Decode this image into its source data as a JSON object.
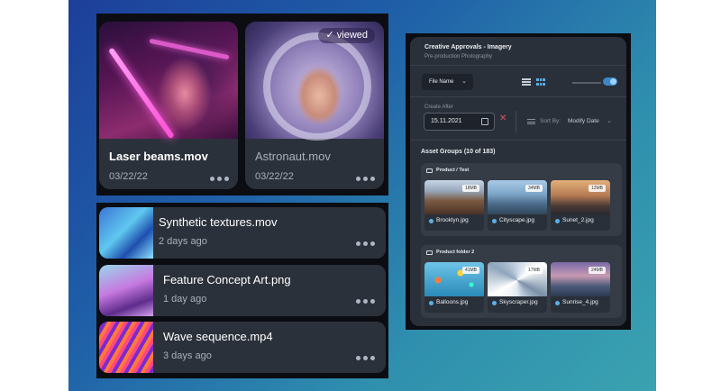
{
  "cards": [
    {
      "title": "Laser beams.mov",
      "date": "03/22/22",
      "viewed": ""
    },
    {
      "title": "Astronaut.mov",
      "date": "03/22/22",
      "viewed": "✓ viewed"
    }
  ],
  "list": [
    {
      "title": "Synthetic textures.mov",
      "subtitle": "2 days ago"
    },
    {
      "title": "Feature Concept Art.png",
      "subtitle": "1 day ago"
    },
    {
      "title": "Wave sequence.mp4",
      "subtitle": "3 days ago"
    }
  ],
  "app": {
    "title": "Creative Approvals - Imagery",
    "subtitle": "Pre-production Photography",
    "file_dropdown": "File Name",
    "create_after_label": "Create After",
    "create_after_value": "15.11.2021",
    "sort_label": "Sort By:",
    "sort_value": "Modify Date",
    "groups_title": "Asset Groups (10 of 183)",
    "groups": [
      {
        "name": "Product / Test",
        "assets": [
          {
            "name": "Brooklyn.jpg",
            "size": "18MB"
          },
          {
            "name": "Cityscape.jpg",
            "size": "34MB"
          },
          {
            "name": "Sunet_2.jpg",
            "size": "12MB"
          }
        ]
      },
      {
        "name": "Product folder 2",
        "assets": [
          {
            "name": "Balloons.jpg",
            "size": "41MB"
          },
          {
            "name": "Skyscraper.jpg",
            "size": "17MB"
          },
          {
            "name": "Sunrise_4.jpg",
            "size": "24MB"
          }
        ]
      }
    ]
  },
  "colors": {
    "background_gradient_start": "#1d3f9a",
    "background_gradient_end": "#3aa2b0",
    "card": "#2b313b",
    "accent": "#5ab0e6",
    "clear": "#e0525a"
  },
  "icons": [
    "check-icon",
    "more-dots-icon",
    "chevron-down-icon",
    "list-view-icon",
    "grid-view-icon",
    "calendar-icon",
    "close-icon",
    "sort-icon",
    "folder-icon"
  ]
}
